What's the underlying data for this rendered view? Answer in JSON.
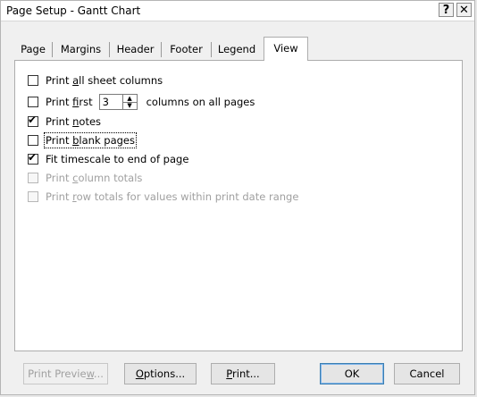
{
  "window": {
    "title": "Page Setup - Gantt Chart",
    "help_glyph": "?",
    "close_glyph": "✕"
  },
  "tabs": [
    {
      "label": "Page",
      "active": false
    },
    {
      "label": "Margins",
      "active": false
    },
    {
      "label": "Header",
      "active": false
    },
    {
      "label": "Footer",
      "active": false
    },
    {
      "label": "Legend",
      "active": false
    },
    {
      "label": "View",
      "active": true
    }
  ],
  "options": {
    "print_all_columns": {
      "pre": "Print ",
      "ul": "a",
      "post": "ll sheet columns",
      "checked": false,
      "enabled": true
    },
    "print_first": {
      "pre": "Print ",
      "ul": "f",
      "post": "irst",
      "checked": false,
      "enabled": true,
      "value": "3",
      "suffix": "columns on all pages"
    },
    "print_notes": {
      "pre": "Print ",
      "ul": "n",
      "post": "otes",
      "checked": true,
      "enabled": true
    },
    "print_blank_pages": {
      "pre": "Print ",
      "ul": "b",
      "post": "lank pages",
      "checked": false,
      "enabled": true
    },
    "fit_timescale": {
      "pre": "Fit timescale to end of pa",
      "ul": "g",
      "post": "e",
      "checked": true,
      "enabled": true
    },
    "print_column_totals": {
      "pre": "Print ",
      "ul": "c",
      "post": "olumn totals",
      "checked": false,
      "enabled": false
    },
    "print_row_totals": {
      "pre": "Print ",
      "ul": "r",
      "post": "ow totals for values within print date range",
      "checked": false,
      "enabled": false
    }
  },
  "check_glyph": "✔",
  "spin": {
    "up": "▲",
    "down": "▼"
  },
  "buttons": {
    "print_preview": {
      "pre": "Print Previe",
      "ul": "w",
      "post": "..."
    },
    "options": {
      "pre": "",
      "ul": "O",
      "post": "ptions..."
    },
    "print": {
      "pre": "",
      "ul": "P",
      "post": "rint..."
    },
    "ok": "OK",
    "cancel": "Cancel"
  }
}
